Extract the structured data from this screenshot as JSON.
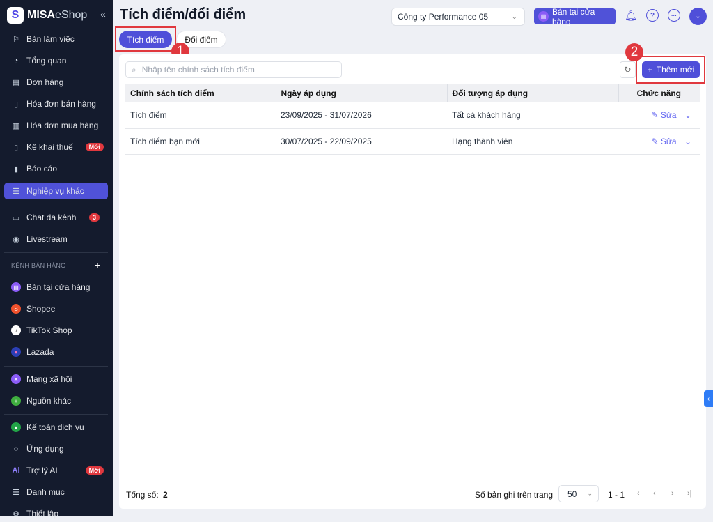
{
  "sidebar": {
    "logo_brand": "MISA",
    "logo_product": "eShop",
    "items": [
      {
        "label": "Bàn làm việc",
        "icon": "flag-icon"
      },
      {
        "label": "Tổng quan",
        "icon": "gauge-icon"
      },
      {
        "label": "Đơn hàng",
        "icon": "order-icon"
      },
      {
        "label": "Hóa đơn bán hàng",
        "icon": "invoice-icon"
      },
      {
        "label": "Hóa đơn mua hàng",
        "icon": "receipt-icon"
      },
      {
        "label": "Kê khai thuế",
        "icon": "tax-icon",
        "badge": "Mới"
      },
      {
        "label": "Báo cáo",
        "icon": "chart-icon"
      },
      {
        "label": "Nghiệp vụ khác",
        "icon": "list-icon"
      },
      {
        "label": "Chat đa kênh",
        "icon": "chat-icon",
        "badge": "3"
      },
      {
        "label": "Livestream",
        "icon": "broadcast-icon"
      }
    ],
    "section_title": "KÊNH BÁN HÀNG",
    "channels": [
      {
        "label": "Bán tại cửa hàng",
        "color": "#8b5cf6"
      },
      {
        "label": "Shopee",
        "color": "#f0522d"
      },
      {
        "label": "TikTok Shop",
        "color": "#ffffff"
      },
      {
        "label": "Lazada",
        "color": "#2b3fb5"
      }
    ],
    "others": [
      {
        "label": "Mạng xã hội",
        "color": "#8b5cf6"
      },
      {
        "label": "Nguồn khác",
        "color": "#3fae3f"
      }
    ],
    "bottom": [
      {
        "label": "Kế toán dịch vụ",
        "icon": "accounting-icon"
      },
      {
        "label": "Ứng dụng",
        "icon": "apps-icon"
      },
      {
        "label": "Trợ lý AI",
        "icon": "ai-icon",
        "badge": "Mới"
      },
      {
        "label": "Danh mục",
        "icon": "menu-icon"
      },
      {
        "label": "Thiết lập",
        "icon": "settings-icon"
      }
    ]
  },
  "header": {
    "title": "Tích điểm/đổi điểm",
    "company": "Công ty Performance 05",
    "store_button": "Bán tại cửa hàng"
  },
  "tabs": [
    {
      "label": "Tích điểm",
      "active": true
    },
    {
      "label": "Đổi điểm",
      "active": false
    }
  ],
  "annotations": [
    "1",
    "2"
  ],
  "toolbar": {
    "search_placeholder": "Nhập tên chính sách tích điểm",
    "add_label": "Thêm mới"
  },
  "table": {
    "columns": [
      "Chính sách tích điểm",
      "Ngày áp dụng",
      "Đối tượng áp dụng",
      "Chức năng"
    ],
    "rows": [
      {
        "name": "Tích điểm",
        "dates": "23/09/2025 - 31/07/2026",
        "target": "Tất cả khách hàng",
        "action": "Sửa"
      },
      {
        "name": "Tích điểm bạn mới",
        "dates": "30/07/2025 - 22/09/2025",
        "target": "Hạng thành viên",
        "action": "Sửa"
      }
    ]
  },
  "footer": {
    "total_label": "Tổng số:",
    "total": "2",
    "per_page_label": "Số bản ghi trên trang",
    "per_page": "50",
    "range": "1 - 1"
  },
  "colors": {
    "accent": "#4f4fd9",
    "sidebar": "#141b2d",
    "highlight": "#e0383e"
  }
}
